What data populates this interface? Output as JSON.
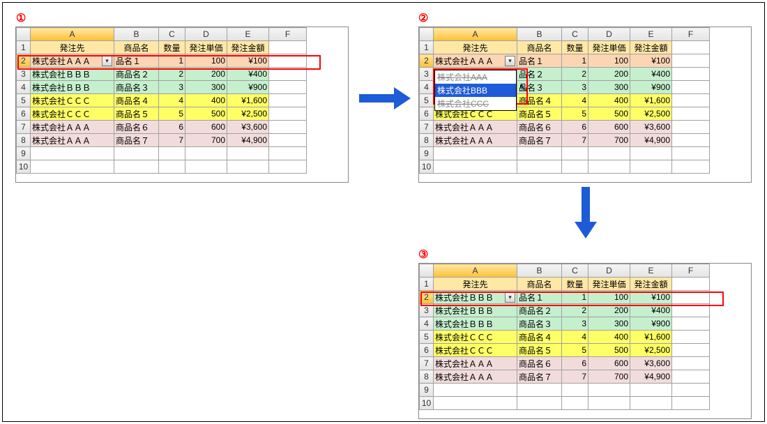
{
  "labels": {
    "p1": "①",
    "p2": "②",
    "p3": "③"
  },
  "columns": [
    "A",
    "B",
    "C",
    "D",
    "E",
    "F"
  ],
  "headers": {
    "client": "発注先",
    "product": "商品名",
    "qty": "数量",
    "unit": "発注単価",
    "amount": "発注金額"
  },
  "rowNums": [
    "1",
    "2",
    "3",
    "4",
    "5",
    "6",
    "7",
    "8",
    "9",
    "10"
  ],
  "panel1": {
    "rows": [
      {
        "client": "株式会社ＡＡＡ",
        "product": "品名１",
        "qty": "1",
        "unit": "100",
        "amount": "¥100",
        "cls": "c-peach",
        "hasDropdown": true
      },
      {
        "client": "株式会社ＢＢＢ",
        "product": "商品名２",
        "qty": "2",
        "unit": "200",
        "amount": "¥400",
        "cls": "c-green"
      },
      {
        "client": "株式会社ＢＢＢ",
        "product": "商品名３",
        "qty": "3",
        "unit": "300",
        "amount": "¥900",
        "cls": "c-green"
      },
      {
        "client": "株式会社ＣＣＣ",
        "product": "商品名４",
        "qty": "4",
        "unit": "400",
        "amount": "¥1,600",
        "cls": "c-yellow"
      },
      {
        "client": "株式会社ＣＣＣ",
        "product": "商品名５",
        "qty": "5",
        "unit": "500",
        "amount": "¥2,500",
        "cls": "c-yellow"
      },
      {
        "client": "株式会社ＡＡＡ",
        "product": "商品名６",
        "qty": "6",
        "unit": "600",
        "amount": "¥3,600",
        "cls": "c-pink"
      },
      {
        "client": "株式会社ＡＡＡ",
        "product": "商品名７",
        "qty": "7",
        "unit": "700",
        "amount": "¥4,900",
        "cls": "c-pink"
      }
    ]
  },
  "panel2": {
    "rows": [
      {
        "client": "株式会社ＡＡＡ",
        "product": "品名１",
        "qty": "1",
        "unit": "100",
        "amount": "¥100",
        "cls": "c-peach",
        "hasDropdown": true
      },
      {
        "client": "",
        "product": "品名２",
        "qty": "2",
        "unit": "200",
        "amount": "¥400",
        "cls": "c-green"
      },
      {
        "client": "",
        "product": "品名３",
        "qty": "3",
        "unit": "300",
        "amount": "¥900",
        "cls": "c-green"
      },
      {
        "client": "株式会社ＣＣＣ",
        "product": "商品名４",
        "qty": "4",
        "unit": "400",
        "amount": "¥1,600",
        "cls": "c-yellow"
      },
      {
        "client": "株式会社ＣＣＣ",
        "product": "商品名５",
        "qty": "5",
        "unit": "500",
        "amount": "¥2,500",
        "cls": "c-yellow"
      },
      {
        "client": "株式会社ＡＡＡ",
        "product": "商品名６",
        "qty": "6",
        "unit": "600",
        "amount": "¥3,600",
        "cls": "c-pink"
      },
      {
        "client": "株式会社ＡＡＡ",
        "product": "商品名７",
        "qty": "7",
        "unit": "700",
        "amount": "¥4,900",
        "cls": "c-pink"
      }
    ],
    "dropdown": {
      "options": [
        "株式会社AAA",
        "株式会社BBB",
        "株式会社CCC"
      ],
      "selectedIndex": 1
    }
  },
  "panel3": {
    "rows": [
      {
        "client": "株式会社ＢＢＢ",
        "product": "品名１",
        "qty": "1",
        "unit": "100",
        "amount": "¥100",
        "cls": "c-green",
        "hasDropdown": true
      },
      {
        "client": "株式会社ＢＢＢ",
        "product": "商品名２",
        "qty": "2",
        "unit": "200",
        "amount": "¥400",
        "cls": "c-green"
      },
      {
        "client": "株式会社ＢＢＢ",
        "product": "商品名３",
        "qty": "3",
        "unit": "300",
        "amount": "¥900",
        "cls": "c-green"
      },
      {
        "client": "株式会社ＣＣＣ",
        "product": "商品名４",
        "qty": "4",
        "unit": "400",
        "amount": "¥1,600",
        "cls": "c-yellow"
      },
      {
        "client": "株式会社ＣＣＣ",
        "product": "商品名５",
        "qty": "5",
        "unit": "500",
        "amount": "¥2,500",
        "cls": "c-yellow"
      },
      {
        "client": "株式会社ＡＡＡ",
        "product": "商品名６",
        "qty": "6",
        "unit": "600",
        "amount": "¥3,600",
        "cls": "c-pink"
      },
      {
        "client": "株式会社ＡＡＡ",
        "product": "商品名７",
        "qty": "7",
        "unit": "700",
        "amount": "¥4,900",
        "cls": "c-pink"
      }
    ]
  }
}
